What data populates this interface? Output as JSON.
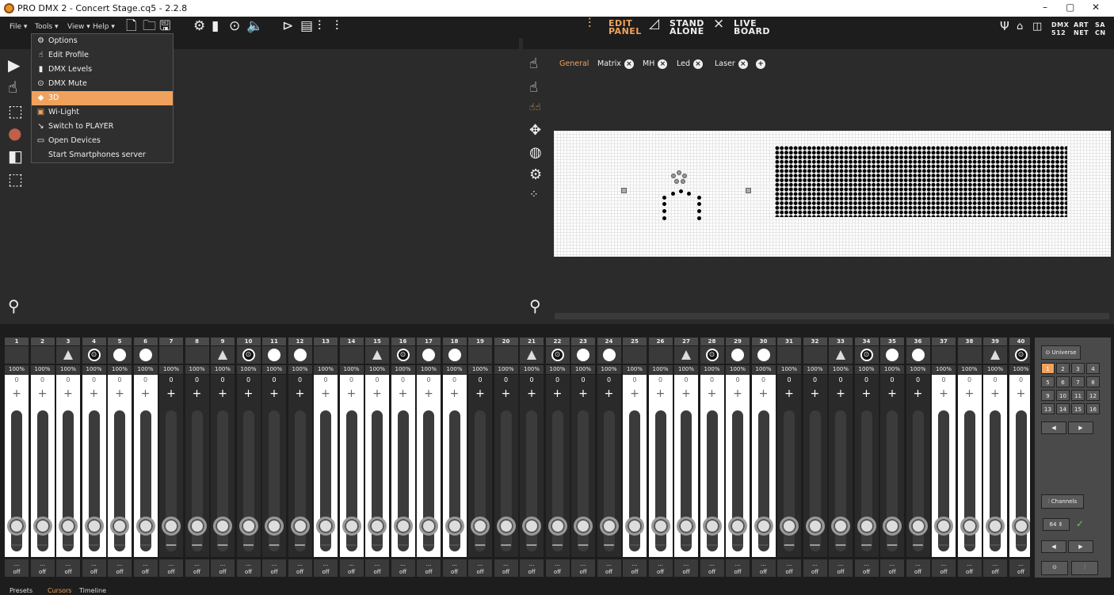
{
  "titlebar": {
    "title": "PRO DMX 2 - Concert Stage.cq5 - 2.2.8",
    "minimize": "–",
    "maximize": "▢",
    "close": "✕"
  },
  "menubar": {
    "file": "File ▾",
    "tools": "Tools ▾",
    "view": "View ▾",
    "help": "Help ▾"
  },
  "modes": {
    "edit_line1": "EDIT",
    "edit_line2": "PANEL",
    "stand_line1": "STAND",
    "stand_line2": "ALONE",
    "live_line1": "LIVE",
    "live_line2": "BOARD"
  },
  "right_status": {
    "dmx": "DMX",
    "dmx_num": "512",
    "art": "ART",
    "net": "NET",
    "sa": "SA",
    "cn": "CN"
  },
  "tools_menu": [
    {
      "icon": "gear-icon",
      "glyph": "⚙",
      "label": "Options"
    },
    {
      "icon": "hand-icon",
      "glyph": "☝",
      "label": "Edit Profile"
    },
    {
      "icon": "levels-icon",
      "glyph": "▮",
      "label": "DMX Levels"
    },
    {
      "icon": "dmx-mute-icon",
      "glyph": "⊙",
      "label": "DMX Mute"
    },
    {
      "icon": "cube-icon",
      "glyph": "◆",
      "label": "3D"
    },
    {
      "icon": "wilight-icon",
      "glyph": "▣",
      "label": "Wi-Light"
    },
    {
      "icon": "switch-icon",
      "glyph": "↘",
      "label": "Switch to PLAYER"
    },
    {
      "icon": "folder-icon",
      "glyph": "▭",
      "label": "Open Devices"
    },
    {
      "icon": "none",
      "glyph": "",
      "label": "Start Smartphones server"
    }
  ],
  "tabs": [
    {
      "label": "General",
      "active": true,
      "closable": false
    },
    {
      "label": "Matrix",
      "active": false,
      "closable": true
    },
    {
      "label": "MH",
      "active": false,
      "closable": true
    },
    {
      "label": "Led",
      "active": false,
      "closable": true
    },
    {
      "label": "Laser",
      "active": false,
      "closable": true
    }
  ],
  "add_tab": "+",
  "channels_labels": [
    "1",
    "2",
    "3",
    "4",
    "5",
    "6",
    "7",
    "8",
    "9",
    "10",
    "11",
    "12",
    "13",
    "14",
    "15",
    "16",
    "17",
    "18",
    "19",
    "20",
    "21",
    "22",
    "23",
    "24",
    "25",
    "26",
    "27",
    "28",
    "29",
    "30",
    "31",
    "32",
    "33",
    "34",
    "35",
    "36",
    "37",
    "38",
    "39",
    "40"
  ],
  "channel_icons": [
    "none",
    "none",
    "triangle",
    "dot",
    "circle",
    "circle",
    "none",
    "none",
    "triangle",
    "dot",
    "circle",
    "circle",
    "none",
    "none",
    "triangle",
    "dot",
    "circle",
    "circle",
    "none",
    "none",
    "triangle",
    "dot",
    "circle",
    "circle",
    "none",
    "none",
    "triangle",
    "dot",
    "circle",
    "circle",
    "none",
    "none",
    "triangle",
    "dot",
    "circle",
    "circle",
    "none",
    "none",
    "triangle",
    "dot"
  ],
  "channel_percent": "100%",
  "channel_value": "0",
  "channel_off": "off",
  "channel_dots": "...",
  "universe": {
    "label": "Universe",
    "numbers": [
      "1",
      "2",
      "3",
      "4",
      "5",
      "6",
      "7",
      "8",
      "9",
      "10",
      "11",
      "12",
      "13",
      "14",
      "15",
      "16"
    ],
    "selected": "1"
  },
  "channels_panel": {
    "label": "Channels",
    "value": "64"
  },
  "footer": {
    "presets": "Presets",
    "cursors": "Cursors",
    "timeline": "Timeline"
  },
  "colors": {
    "accent": "#f0a25c",
    "panel": "#2b2b2b"
  }
}
